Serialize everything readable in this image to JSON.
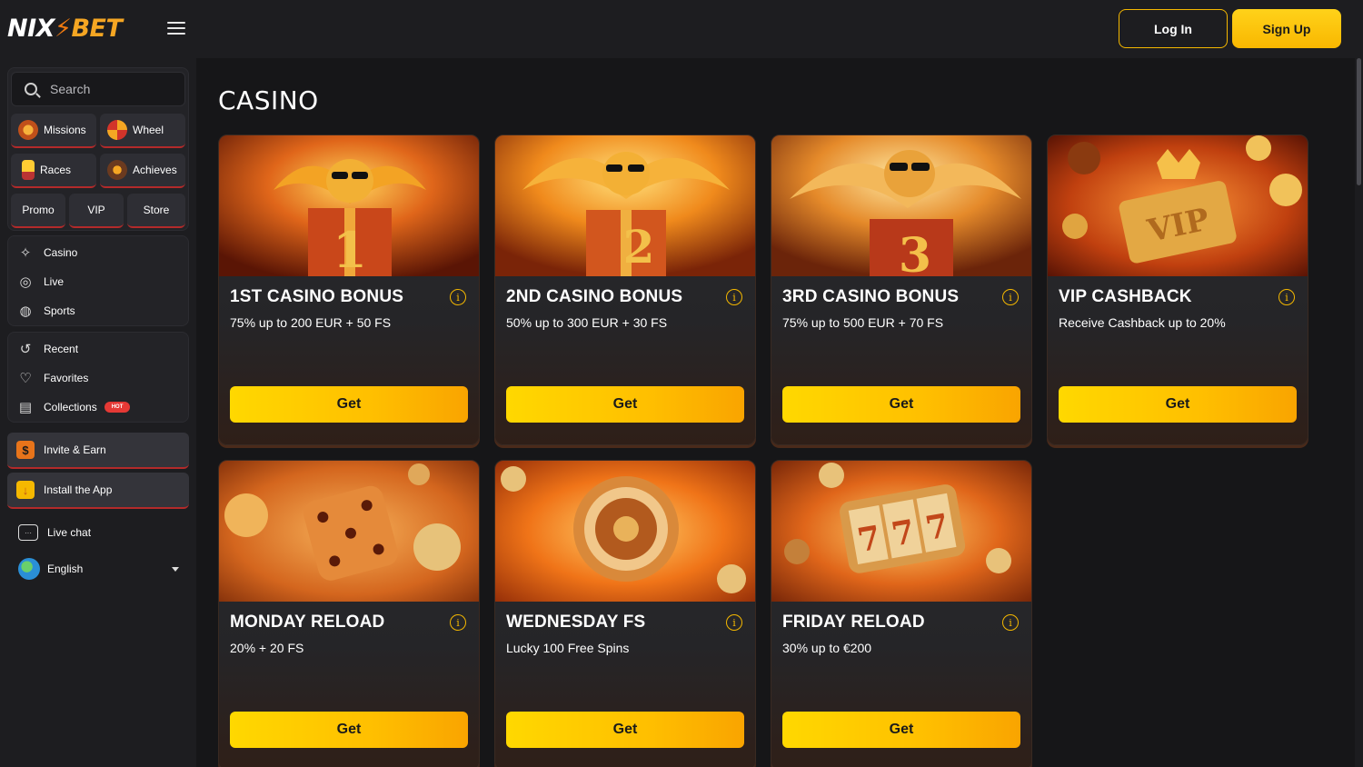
{
  "header": {
    "logo": {
      "part1": "NIX",
      "part2": "BET"
    },
    "login_label": "Log In",
    "signup_label": "Sign Up"
  },
  "sidebar": {
    "search_placeholder": "Search",
    "quick_buttons": [
      {
        "label": "Missions",
        "icon": "missions-icon"
      },
      {
        "label": "Wheel",
        "icon": "wheel-icon"
      },
      {
        "label": "Races",
        "icon": "races-icon"
      },
      {
        "label": "Achieves",
        "icon": "achieves-icon"
      }
    ],
    "small_buttons": [
      {
        "label": "Promo"
      },
      {
        "label": "VIP"
      },
      {
        "label": "Store"
      }
    ],
    "nav": [
      {
        "label": "Casino",
        "icon": "casino-icon"
      },
      {
        "label": "Live",
        "icon": "live-icon"
      },
      {
        "label": "Sports",
        "icon": "sports-icon"
      }
    ],
    "library": [
      {
        "label": "Recent",
        "icon": "recent-icon"
      },
      {
        "label": "Favorites",
        "icon": "heart-icon"
      },
      {
        "label": "Collections",
        "icon": "collections-icon",
        "badge": "HOT"
      }
    ],
    "invite_label": "Invite & Earn",
    "install_label": "Install the App",
    "live_chat_label": "Live chat",
    "language": "English"
  },
  "main": {
    "title": "CASINO",
    "cards": [
      {
        "title": "1ST CASINO BONUS",
        "subtitle": "75% up to 200 EUR + 50 FS",
        "button": "Get",
        "art": "phoenix-gift-1"
      },
      {
        "title": "2ND CASINO BONUS",
        "subtitle": "50% up to 300 EUR + 30 FS",
        "button": "Get",
        "art": "phoenix-gift-2"
      },
      {
        "title": "3RD CASINO BONUS",
        "subtitle": "75% up to 500 EUR + 70 FS",
        "button": "Get",
        "art": "phoenix-gift-3"
      },
      {
        "title": "VIP CASHBACK",
        "subtitle": "Receive Cashback up to 20%",
        "button": "Get",
        "art": "vip-crown"
      },
      {
        "title": "MONDAY RELOAD",
        "subtitle": "20% + 20 FS",
        "button": "Get",
        "art": "dice"
      },
      {
        "title": "WEDNESDAY FS",
        "subtitle": "Lucky 100 Free Spins",
        "button": "Get",
        "art": "roulette"
      },
      {
        "title": "FRIDAY RELOAD",
        "subtitle": "30% up to €200",
        "button": "Get",
        "art": "slot-777"
      }
    ]
  },
  "colors": {
    "accent": "#f9b700",
    "background": "#161618",
    "sidebar": "#1d1d20",
    "hot_badge": "#e53935"
  }
}
